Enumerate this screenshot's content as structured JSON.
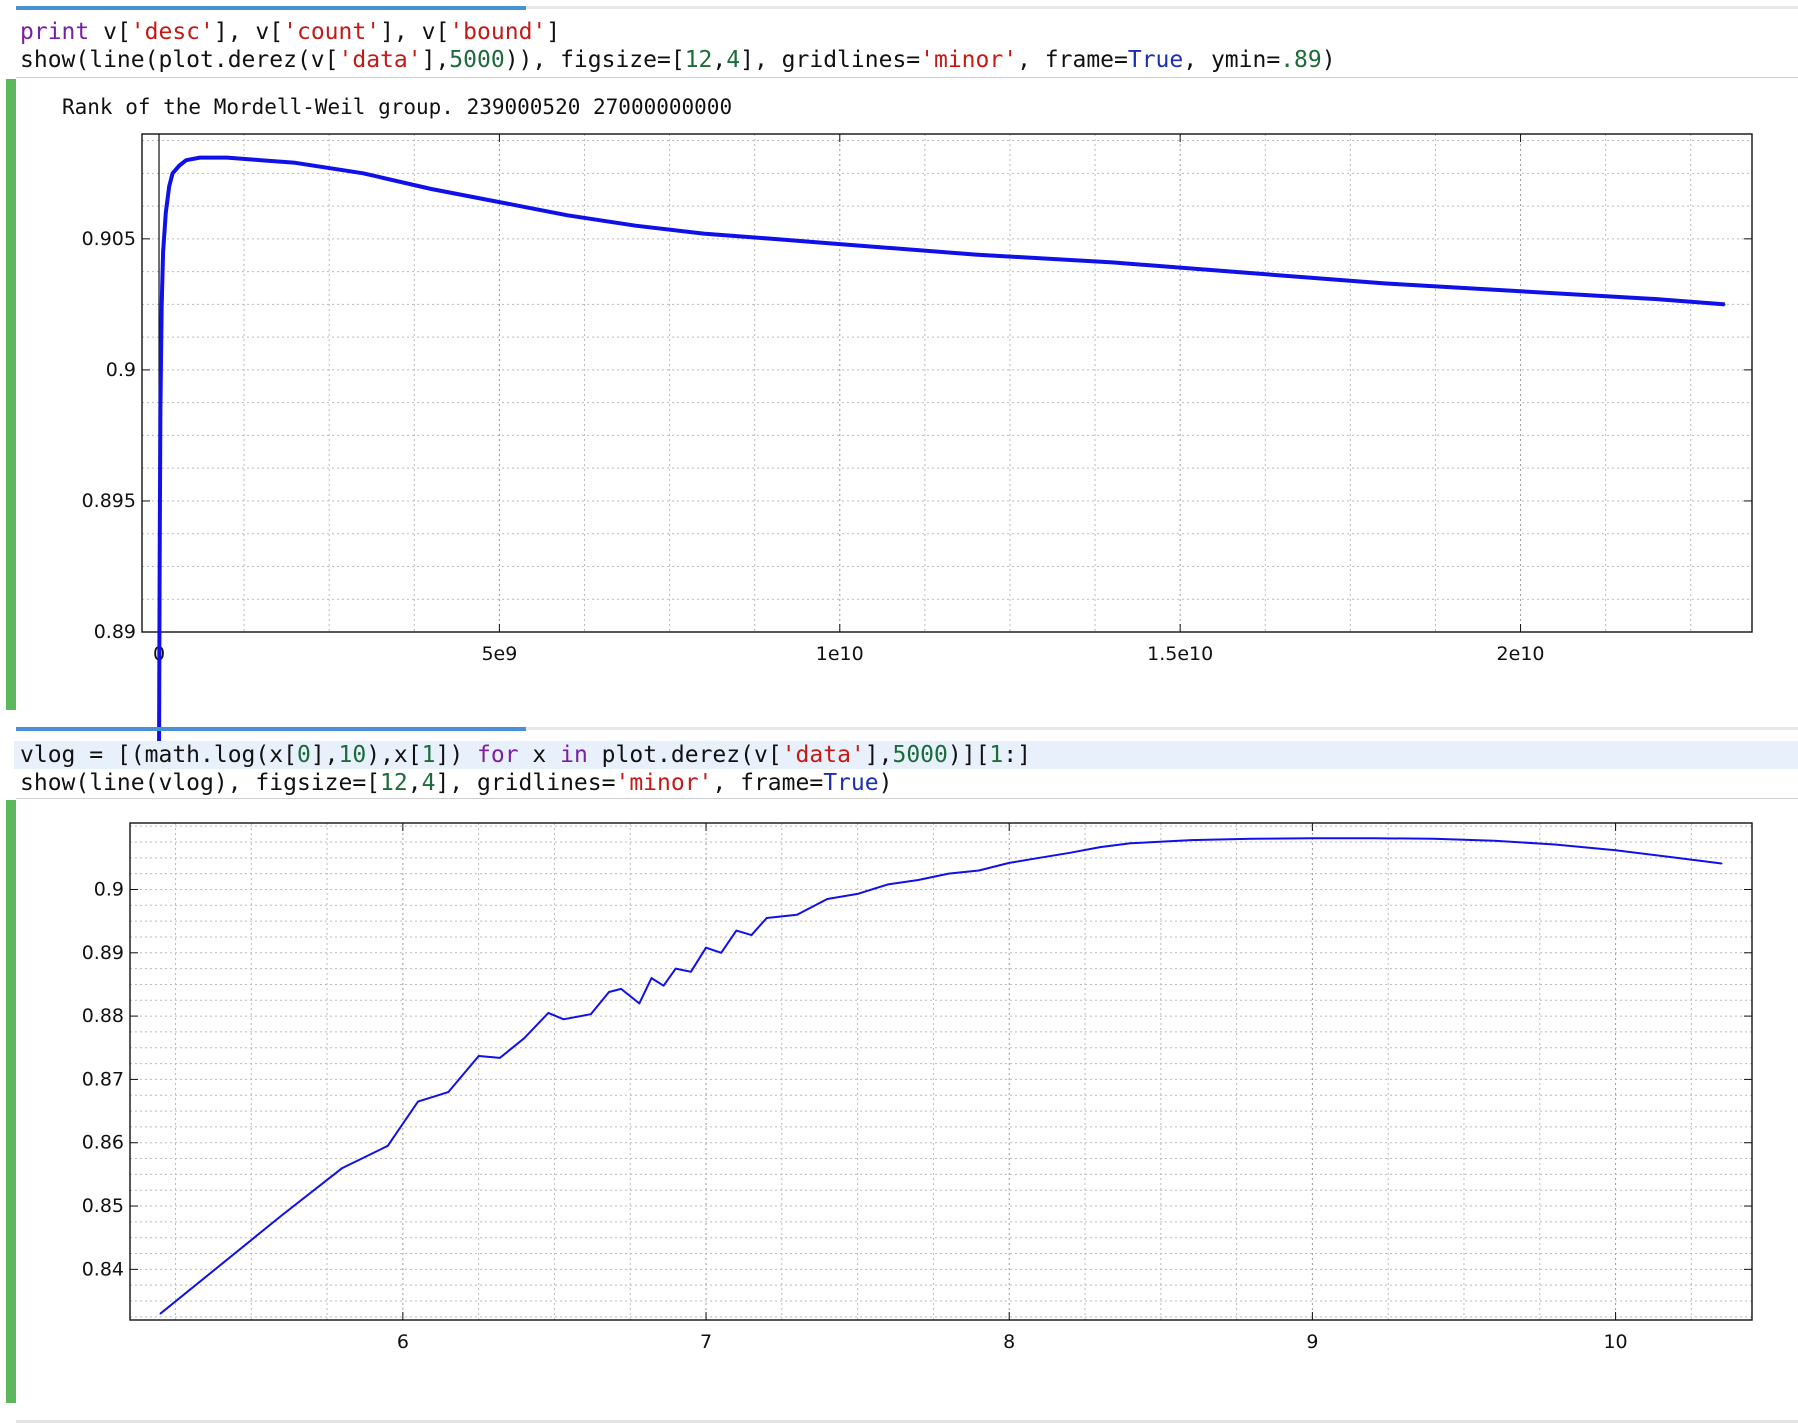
{
  "cells": [
    {
      "input": [
        [
          [
            "kw",
            "print"
          ],
          [
            "t",
            " v["
          ],
          [
            "str",
            "'desc'"
          ],
          [
            "t",
            "], v["
          ],
          [
            "str",
            "'count'"
          ],
          [
            "t",
            "], v["
          ],
          [
            "str",
            "'bound'"
          ],
          [
            "t",
            "]"
          ]
        ],
        [
          [
            "t",
            "show(line(plot.derez(v["
          ],
          [
            "str",
            "'data'"
          ],
          [
            "t",
            "],"
          ],
          [
            "num",
            "5000"
          ],
          [
            "t",
            ")), figsize=["
          ],
          [
            "num",
            "12"
          ],
          [
            "t",
            ","
          ],
          [
            "num",
            "4"
          ],
          [
            "t",
            "], gridlines="
          ],
          [
            "str",
            "'minor'"
          ],
          [
            "t",
            ", frame="
          ],
          [
            "bi",
            "True"
          ],
          [
            "t",
            ", ymin="
          ],
          [
            "num",
            ".89"
          ],
          [
            "t",
            ")"
          ]
        ]
      ],
      "output_text": "Rank of the Mordell-Weil group. 239000520 27000000000"
    },
    {
      "input": [
        [
          [
            "t",
            "vlog = [(math.log(x["
          ],
          [
            "num",
            "0"
          ],
          [
            "t",
            "],"
          ],
          [
            "num",
            "10"
          ],
          [
            "t",
            "),x["
          ],
          [
            "num",
            "1"
          ],
          [
            "t",
            "]) "
          ],
          [
            "kw",
            "for"
          ],
          [
            "t",
            " x "
          ],
          [
            "kw",
            "in"
          ],
          [
            "t",
            " plot.derez(v["
          ],
          [
            "str",
            "'data'"
          ],
          [
            "t",
            "],"
          ],
          [
            "num",
            "5000"
          ],
          [
            "t",
            ")]["
          ],
          [
            "num",
            "1"
          ],
          [
            "t",
            ":]"
          ]
        ],
        [
          [
            "t",
            "show(line(vlog), figsize=["
          ],
          [
            "num",
            "12"
          ],
          [
            "t",
            ","
          ],
          [
            "num",
            "4"
          ],
          [
            "t",
            "], gridlines="
          ],
          [
            "str",
            "'minor'"
          ],
          [
            "t",
            ", frame="
          ],
          [
            "bi",
            "True"
          ],
          [
            "t",
            ")"
          ]
        ]
      ]
    }
  ],
  "chart_data": [
    {
      "type": "line",
      "title": "",
      "xlabel": "",
      "ylabel": "",
      "xlim": [
        -250000000.0,
        23400000000.0
      ],
      "ylim": [
        0.89,
        0.909
      ],
      "grid": "minor",
      "frame": true,
      "x_ticks": [
        0,
        5000000000.0,
        10000000000.0,
        15000000000.0,
        20000000000.0
      ],
      "x_tick_labels": [
        "0",
        "5e9",
        "1e10",
        "1.5e10",
        "2e10"
      ],
      "y_ticks": [
        0.89,
        0.895,
        0.9,
        0.905
      ],
      "y_tick_labels": [
        "0.89",
        "0.895",
        "0.9",
        "0.905"
      ],
      "color": "#1010e8",
      "series": [
        {
          "x": [
            0,
            10000000.0,
            20000000.0,
            40000000.0,
            60000000.0,
            100000000.0,
            150000000.0,
            200000000.0,
            300000000.0,
            400000000.0,
            600000000.0,
            800000000.0,
            1000000000.0,
            1500000000.0,
            2000000000.0,
            3000000000.0,
            4000000000.0,
            5000000000.0,
            6000000000.0,
            7000000000.0,
            8000000000.0,
            9000000000.0,
            10000000000.0,
            12000000000.0,
            14000000000.0,
            16000000000.0,
            18000000000.0,
            20000000000.0,
            22000000000.0,
            23000000000.0
          ],
          "y": [
            0.885,
            0.893,
            0.8985,
            0.9025,
            0.9045,
            0.906,
            0.907,
            0.9075,
            0.9078,
            0.908,
            0.9081,
            0.9081,
            0.9081,
            0.908,
            0.9079,
            0.9075,
            0.9069,
            0.9064,
            0.9059,
            0.9055,
            0.9052,
            0.905,
            0.9048,
            0.9044,
            0.9041,
            0.9037,
            0.9033,
            0.903,
            0.9027,
            0.9025
          ]
        }
      ]
    },
    {
      "type": "line",
      "title": "",
      "xlabel": "",
      "ylabel": "",
      "xlim": [
        5.1,
        10.45
      ],
      "ylim": [
        0.832,
        0.9105
      ],
      "grid": "minor",
      "frame": true,
      "x_ticks": [
        6,
        7,
        8,
        9,
        10
      ],
      "x_tick_labels": [
        "6",
        "7",
        "8",
        "9",
        "10"
      ],
      "y_ticks": [
        0.84,
        0.85,
        0.86,
        0.87,
        0.88,
        0.89,
        0.9
      ],
      "y_tick_labels": [
        "0.84",
        "0.85",
        "0.86",
        "0.87",
        "0.88",
        "0.89",
        "0.9"
      ],
      "color": "#1010e8",
      "series": [
        {
          "x": [
            5.2,
            5.6,
            5.8,
            5.95,
            6.05,
            6.15,
            6.25,
            6.32,
            6.4,
            6.48,
            6.53,
            6.62,
            6.68,
            6.72,
            6.78,
            6.82,
            6.86,
            6.9,
            6.95,
            7.0,
            7.05,
            7.1,
            7.15,
            7.2,
            7.3,
            7.4,
            7.5,
            7.6,
            7.7,
            7.8,
            7.9,
            8.0,
            8.1,
            8.2,
            8.3,
            8.4,
            8.6,
            8.8,
            9.0,
            9.2,
            9.4,
            9.6,
            9.8,
            10.0,
            10.2,
            10.35
          ],
          "y": [
            0.833,
            0.8485,
            0.856,
            0.8595,
            0.8665,
            0.868,
            0.8737,
            0.8734,
            0.8765,
            0.8805,
            0.8795,
            0.8803,
            0.8838,
            0.8843,
            0.882,
            0.886,
            0.8848,
            0.8875,
            0.887,
            0.8908,
            0.89,
            0.8935,
            0.8928,
            0.8955,
            0.896,
            0.8985,
            0.8993,
            0.9008,
            0.9015,
            0.9025,
            0.903,
            0.9042,
            0.905,
            0.9058,
            0.9067,
            0.9073,
            0.9078,
            0.908,
            0.9081,
            0.9081,
            0.908,
            0.9077,
            0.9071,
            0.9062,
            0.905,
            0.9041
          ]
        }
      ]
    }
  ]
}
